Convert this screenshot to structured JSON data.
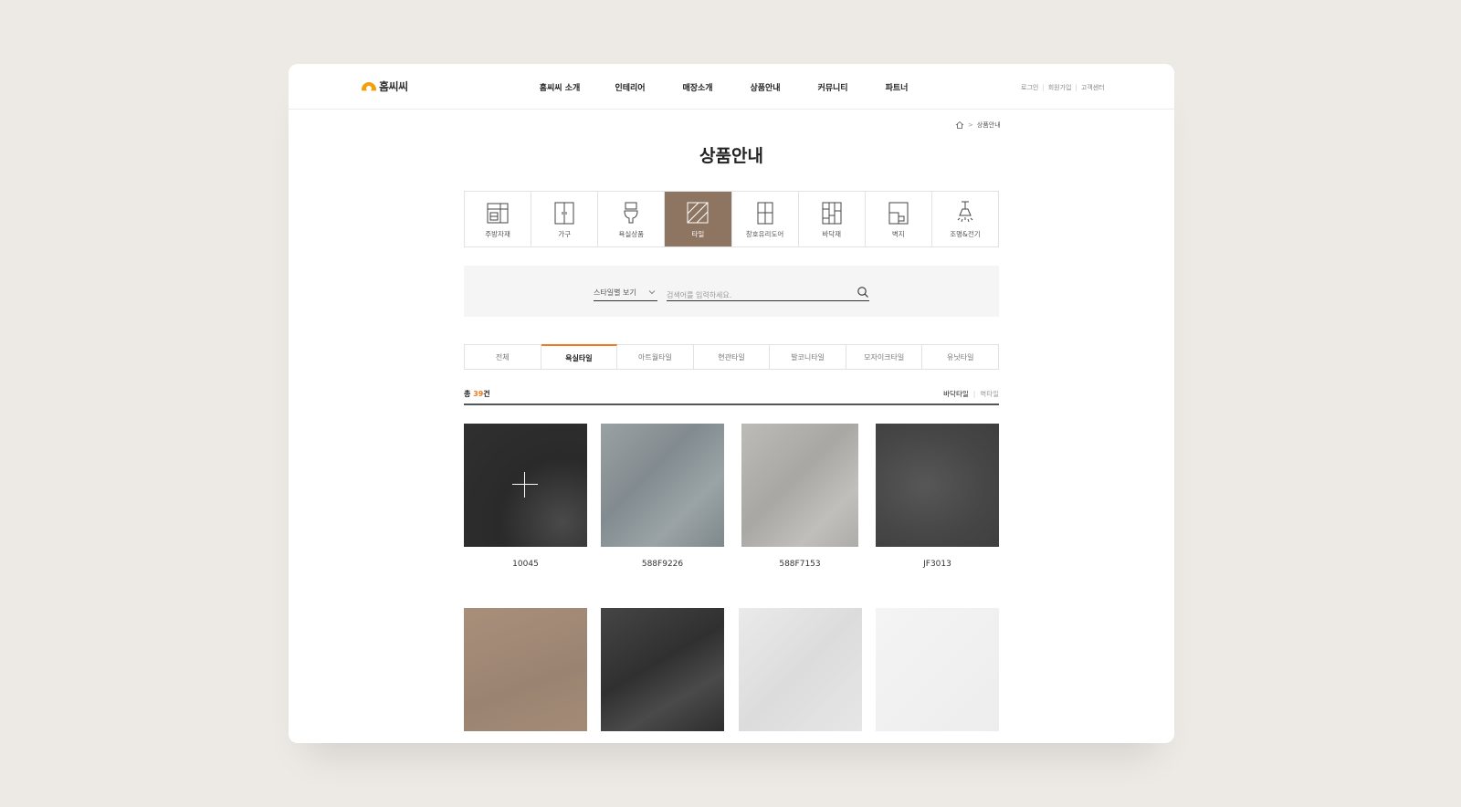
{
  "header": {
    "logo_text": "홈씨씨",
    "nav": [
      "홈씨씨 소개",
      "인테리어",
      "매장소개",
      "상품안내",
      "커뮤니티",
      "파트너"
    ],
    "util": [
      "로그인",
      "회원가입",
      "고객센터"
    ]
  },
  "breadcrumb": {
    "current": "상품안내"
  },
  "page_title": "상품안내",
  "categories": [
    {
      "label": "주방자재",
      "icon": "kitchen-icon",
      "active": false
    },
    {
      "label": "가구",
      "icon": "wardrobe-icon",
      "active": false
    },
    {
      "label": "욕실상품",
      "icon": "toilet-icon",
      "active": false
    },
    {
      "label": "타일",
      "icon": "tile-icon",
      "active": true
    },
    {
      "label": "창호유리도어",
      "icon": "window-icon",
      "active": false
    },
    {
      "label": "바닥재",
      "icon": "floor-icon",
      "active": false
    },
    {
      "label": "벽지",
      "icon": "wallpaper-icon",
      "active": false
    },
    {
      "label": "조명&전기",
      "icon": "lamp-icon",
      "active": false
    }
  ],
  "search": {
    "style_select": "스타일별 보기",
    "placeholder": "검색어를 입력하세요."
  },
  "subtabs": [
    {
      "label": "전체",
      "active": false
    },
    {
      "label": "욕실타일",
      "active": true
    },
    {
      "label": "아트월타일",
      "active": false
    },
    {
      "label": "현관타일",
      "active": false
    },
    {
      "label": "발코니타일",
      "active": false
    },
    {
      "label": "모자이크타일",
      "active": false
    },
    {
      "label": "유닛타일",
      "active": false
    }
  ],
  "count": {
    "prefix": "총 ",
    "number": "39",
    "suffix": "건"
  },
  "filters": {
    "floor": "바닥타일",
    "wall": "벽타일"
  },
  "products": [
    {
      "name": "10045",
      "color": "#2f2f2f"
    },
    {
      "name": "588F9226",
      "color": "#8d9599"
    },
    {
      "name": "588F7153",
      "color": "#b4b2ae"
    },
    {
      "name": "JF3013",
      "color": "#4d4d4d"
    },
    {
      "name": "",
      "color": "#a08a76"
    },
    {
      "name": "",
      "color": "#3d3d3d"
    },
    {
      "name": "",
      "color": "#e8e8e8"
    },
    {
      "name": "",
      "color": "#f2f2f2"
    }
  ]
}
